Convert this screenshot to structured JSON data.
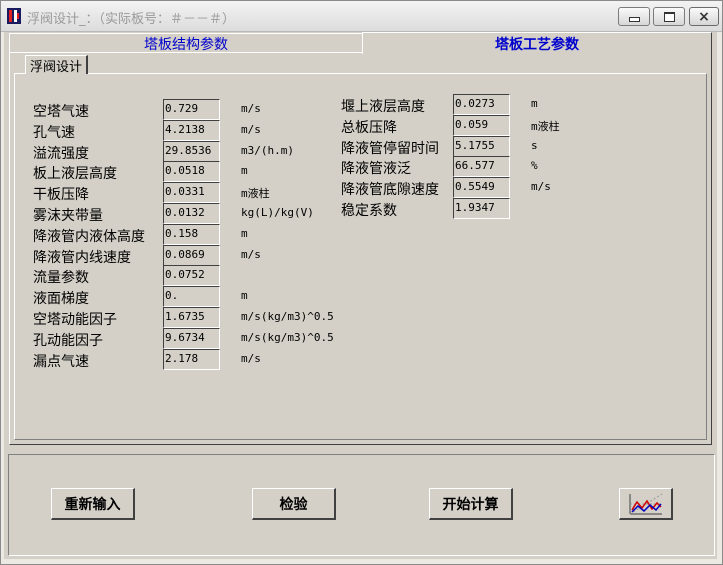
{
  "window": {
    "title": "浮阀设计_：（实际板号：＃－－＃）",
    "app_icon": "app-icon",
    "controls": {
      "minimize_icon": "minimize-icon",
      "maximize_icon": "maximize-icon",
      "close_icon": "close-icon"
    }
  },
  "tabs": [
    {
      "label": "塔板结构参数",
      "active": false
    },
    {
      "label": "塔板工艺参数",
      "active": true
    }
  ],
  "subtab": {
    "label": "浮阀设计"
  },
  "left_params": [
    {
      "label": "空塔气速",
      "value": "0.729",
      "unit": "m/s"
    },
    {
      "label": "孔气速",
      "value": "4.2138",
      "unit": "m/s"
    },
    {
      "label": "溢流强度",
      "value": "29.8536",
      "unit": "m3/(h.m)"
    },
    {
      "label": "板上液层高度",
      "value": "0.0518",
      "unit": "m"
    },
    {
      "label": "干板压降",
      "value": "0.0331",
      "unit": "m液柱"
    },
    {
      "label": "雾沫夹带量",
      "value": "0.0132",
      "unit": "kg(L)/kg(V)"
    },
    {
      "label": "降液管内液体高度",
      "value": "0.158",
      "unit": "m"
    },
    {
      "label": "降液管内线速度",
      "value": "0.0869",
      "unit": "m/s"
    },
    {
      "label": "流量参数",
      "value": "0.0752",
      "unit": ""
    },
    {
      "label": "液面梯度",
      "value": "0.",
      "unit": "m"
    },
    {
      "label": "空塔动能因子",
      "value": "1.6735",
      "unit": "m/s(kg/m3)^0.5"
    },
    {
      "label": "孔动能因子",
      "value": "9.6734",
      "unit": "m/s(kg/m3)^0.5"
    },
    {
      "label": "漏点气速",
      "value": "2.178",
      "unit": "m/s"
    }
  ],
  "right_params": [
    {
      "label": "堰上液层高度",
      "value": "0.0273",
      "unit": "m"
    },
    {
      "label": "总板压降",
      "value": "0.059",
      "unit": "m液柱"
    },
    {
      "label": "降液管停留时间",
      "value": "5.1755",
      "unit": "s"
    },
    {
      "label": "降液管液泛",
      "value": "66.577",
      "unit": "%"
    },
    {
      "label": "降液管底隙速度",
      "value": "0.5549",
      "unit": "m/s"
    },
    {
      "label": "稳定系数",
      "value": "1.9347",
      "unit": ""
    }
  ],
  "buttons": {
    "reset": "重新输入",
    "check": "检验",
    "calculate": "开始计算",
    "chart_icon": "line-chart-icon"
  },
  "colors": {
    "tab_text": "#0000cc",
    "face": "#d4d0c8"
  }
}
